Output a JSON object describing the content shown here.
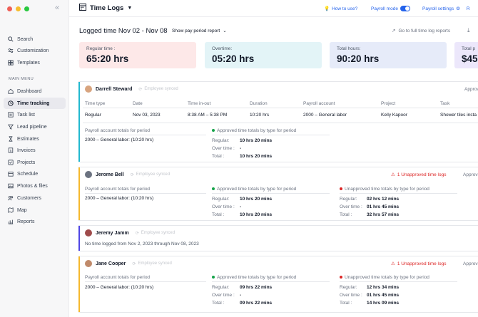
{
  "window": {
    "dot_colors": [
      "#ef5f57",
      "#f7bd2e",
      "#2ac840"
    ]
  },
  "sidebar": {
    "search": "Search",
    "customization": "Customization",
    "templates": "Templates",
    "section_label": "MAIN MENU",
    "items": [
      {
        "label": "Dashboard",
        "icon": "home-icon"
      },
      {
        "label": "Time tracking",
        "icon": "clock-icon"
      },
      {
        "label": "Task list",
        "icon": "list-icon"
      },
      {
        "label": "Lead pipeline",
        "icon": "funnel-icon"
      },
      {
        "label": "Estimates",
        "icon": "hourglass-icon"
      },
      {
        "label": "Invoices",
        "icon": "invoice-icon"
      },
      {
        "label": "Projects",
        "icon": "folder-icon"
      },
      {
        "label": "Schedule",
        "icon": "calendar-icon"
      },
      {
        "label": "Photos & files",
        "icon": "photo-icon"
      },
      {
        "label": "Customers",
        "icon": "users-icon"
      },
      {
        "label": "Map",
        "icon": "map-icon"
      },
      {
        "label": "Reports",
        "icon": "reports-icon"
      }
    ],
    "active_item": "Time tracking"
  },
  "topbar": {
    "title": "Time Logs",
    "how_to_use": "How to use?",
    "payroll_mode": "Payroll mode",
    "payroll_settings": "Payroll settings",
    "accent": "#2563eb"
  },
  "header": {
    "title": "Logged time Nov 02 - Nov 08",
    "period_select": "Show pay period report",
    "full_log_link": "Go to full time log reports"
  },
  "stats": [
    {
      "label": "Regular time :",
      "value": "65:20 hrs",
      "bg": "#fde8e8"
    },
    {
      "label": "Overtime:",
      "value": "05:20 hrs",
      "bg": "#e3f4f7"
    },
    {
      "label": "Total hours:",
      "value": "90:20 hrs",
      "bg": "#e6ebf9"
    },
    {
      "label": "Total p",
      "value": "$45",
      "bg": "#ece7fb"
    }
  ],
  "approve_label": "Approv",
  "synced_label": "Employee synced",
  "payroll_totals_label": "Payroll account totals for period",
  "approved_label": "Approved time totals by type for period",
  "unapproved_label": "Unapproved time totals by type for period",
  "regular_label": "Regular:",
  "overtime_label": "Over time :",
  "total_label": "Total :",
  "darrell": {
    "name": "Darrell Steward",
    "table_headers": [
      "Time type",
      "Date",
      "Time in-out",
      "Duration",
      "Payroll account",
      "Project",
      "Task"
    ],
    "row": [
      "Regular",
      "Nov 03, 2023",
      "8:38 AM – 5:38 PM",
      "10:20 hrs",
      "2000 – General labor",
      "Kelly Kapoor",
      "Shower tiles insta"
    ],
    "payroll_account": "2000 – General labor: (10:20 hrs)",
    "approved": {
      "regular": "10 hrs 20 mins",
      "overtime": "-",
      "total": "10 hrs 20 mins"
    }
  },
  "jerome": {
    "name": "Jerome Bell",
    "unapproved_link": "1 Unapproved time logs",
    "payroll_account": "2000 – General labor: (10:20 hrs)",
    "approved": {
      "regular": "10 hrs 20 mins",
      "overtime": "-",
      "total": "10 hrs 20 mins"
    },
    "unapproved": {
      "regular": "02 hrs 12 mins",
      "overtime": "01 hrs 45 mins",
      "total": "32 hrs 57 mins"
    }
  },
  "jeremy": {
    "name": "Jeremy Jamm",
    "note": "No time logged from Nov 2, 2023 through Nov 08, 2023"
  },
  "jane": {
    "name": "Jane Cooper",
    "unapproved_link": "1 Unapproved time logs",
    "payroll_account": "2000 – General labor: (10:20 hrs)",
    "approved": {
      "regular": "09 hrs 22 mins",
      "overtime": "-",
      "total": "09 hrs 22 mins"
    },
    "unapproved": {
      "regular": "12 hrs 34 mins",
      "overtime": "01 hrs 45 mins",
      "total": "14 hrs 09 mins"
    }
  }
}
